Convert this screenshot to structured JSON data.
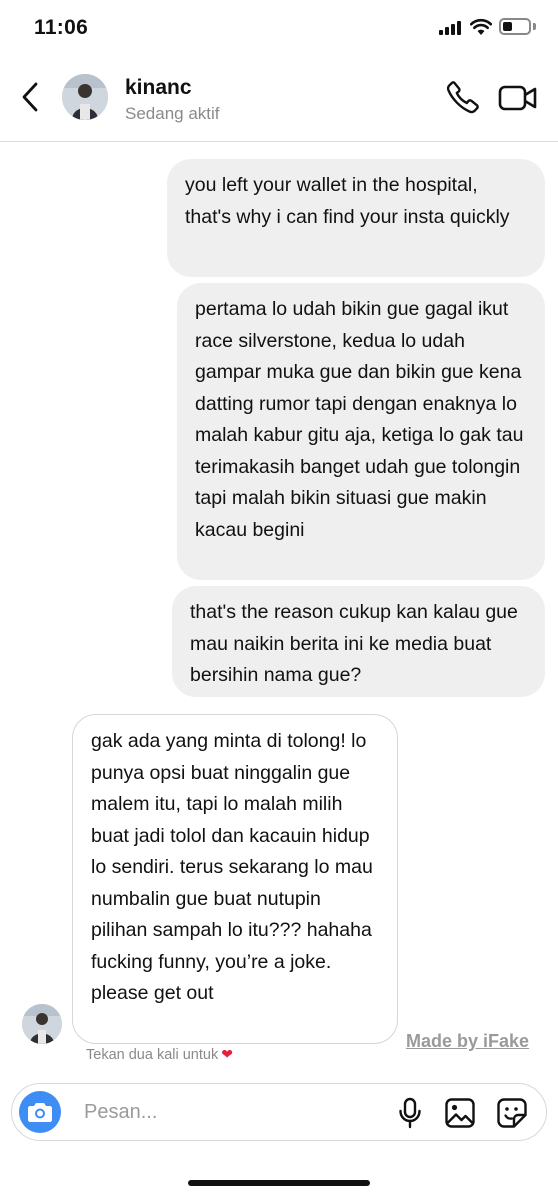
{
  "status_bar": {
    "time": "11:06",
    "battery_level": 0.25
  },
  "header": {
    "contact_name": "kinanc",
    "contact_status": "Sedang aktif"
  },
  "messages": [
    {
      "direction": "outgoing",
      "text": "you left your wallet in the hospital, that's why i can find your insta quickly"
    },
    {
      "direction": "outgoing",
      "text": "pertama lo udah bikin gue gagal ikut race silverstone, kedua lo udah gampar muka gue dan bikin gue kena datting rumor tapi dengan enaknya lo malah kabur gitu aja, ketiga lo gak tau terimakasih banget udah gue tolongin tapi malah bikin situasi gue makin kacau begini"
    },
    {
      "direction": "outgoing",
      "text": "that's the reason cukup kan kalau gue mau naikin berita ini ke media buat bersihin nama gue?"
    },
    {
      "direction": "incoming",
      "text": "gak ada yang minta di tolong! lo punya opsi buat ninggalin gue malem itu, tapi lo malah milih buat jadi tolol dan kacauin hidup lo sendiri. terus sekarang lo mau numbalin gue buat nutupin pilihan sampah lo itu??? hahaha fucking funny, you’re a joke. please get out"
    }
  ],
  "watermark": "Made by iFake",
  "reaction_hint": "Tekan dua kali untuk",
  "composer": {
    "placeholder": "Pesan..."
  },
  "colors": {
    "accent": "#3d8df5",
    "outgoing_bubble": "#efefef",
    "heart": "#e3213b"
  },
  "icons": [
    "back-chevron-icon",
    "phone-icon",
    "video-camera-icon",
    "camera-icon",
    "microphone-icon",
    "gallery-icon",
    "sticker-icon",
    "heart-icon"
  ]
}
